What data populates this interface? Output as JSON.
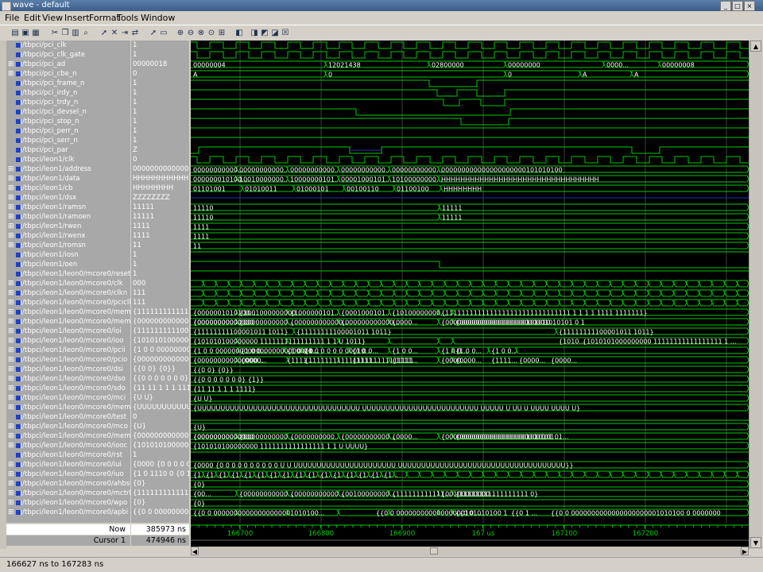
{
  "window": {
    "title": "wave - default",
    "buttons": [
      "_",
      "□",
      "×"
    ]
  },
  "menu": [
    "File",
    "Edit",
    "View",
    "Insert",
    "Format",
    "Tools",
    "Window"
  ],
  "toolbar_icons": [
    "open-icon",
    "save-icon",
    "print-icon",
    "cut-icon",
    "copy-icon",
    "paste-icon",
    "find-icon",
    "select-icon",
    "delete-icon",
    "insert-icon",
    "move-icon",
    "pointer-icon",
    "zoom-box-icon",
    "zoom-in-icon",
    "zoom-out-icon",
    "zoom-full-icon",
    "zoom-cursor-icon",
    "add-cursor-icon",
    "prev-edge-icon",
    "next-edge-icon",
    "prev-edge2-icon",
    "next-edge2-icon",
    "close-cursor-icon"
  ],
  "signals": [
    {
      "name": "/tbpci/pci_clk",
      "value": "1",
      "exp": false
    },
    {
      "name": "/tbpci/pci_clk_gate",
      "value": "1",
      "exp": false
    },
    {
      "name": "/tbpci/pci_ad",
      "value": "00000018",
      "exp": true
    },
    {
      "name": "/tbpci/pci_cbe_n",
      "value": "0",
      "exp": true
    },
    {
      "name": "/tbpci/pci_frame_n",
      "value": "1",
      "exp": false
    },
    {
      "name": "/tbpci/pci_irdy_n",
      "value": "1",
      "exp": false
    },
    {
      "name": "/tbpci/pci_trdy_n",
      "value": "1",
      "exp": false
    },
    {
      "name": "/tbpci/pci_devsel_n",
      "value": "1",
      "exp": false
    },
    {
      "name": "/tbpci/pci_stop_n",
      "value": "1",
      "exp": false
    },
    {
      "name": "/tbpci/pci_perr_n",
      "value": "1",
      "exp": false
    },
    {
      "name": "/tbpci/pci_serr_n",
      "value": "1",
      "exp": false
    },
    {
      "name": "/tbpci/pci_par",
      "value": "Z",
      "exp": false
    },
    {
      "name": "/tbpci/leon1/clk",
      "value": "0",
      "exp": false
    },
    {
      "name": "/tbpci/leon1/address",
      "value": "000000000000001000",
      "exp": true
    },
    {
      "name": "/tbpci/leon1/data",
      "value": "HHHHHHHHHHHHHHHHH",
      "exp": true
    },
    {
      "name": "/tbpci/leon1/cb",
      "value": "HHHHHHHH",
      "exp": true
    },
    {
      "name": "/tbpci/leon1/dsx",
      "value": "ZZZZZZZZ",
      "exp": true
    },
    {
      "name": "/tbpci/leon1/ramsn",
      "value": "11111",
      "exp": true
    },
    {
      "name": "/tbpci/leon1/ramoen",
      "value": "11111",
      "exp": true
    },
    {
      "name": "/tbpci/leon1/rwen",
      "value": "1111",
      "exp": true
    },
    {
      "name": "/tbpci/leon1/rwenx",
      "value": "1111",
      "exp": true
    },
    {
      "name": "/tbpci/leon1/romsn",
      "value": "11",
      "exp": true
    },
    {
      "name": "/tbpci/leon1/iosn",
      "value": "1",
      "exp": false
    },
    {
      "name": "/tbpci/leon1/oen",
      "value": "1",
      "exp": false
    },
    {
      "name": "/tbpci/leon1/leon0/mcore0/resetn",
      "value": "1",
      "exp": false
    },
    {
      "name": "/tbpci/leon1/leon0/mcore0/clk",
      "value": "000",
      "exp": true
    },
    {
      "name": "/tbpci/leon1/leon0/mcore0/clkn",
      "value": "111",
      "exp": true
    },
    {
      "name": "/tbpci/leon1/leon0/mcore0/pciclk",
      "value": "111",
      "exp": true
    },
    {
      "name": "/tbpci/leon1/leon0/mcore0/memi",
      "value": "{11111111111111111",
      "exp": true
    },
    {
      "name": "/tbpci/leon1/leon0/mcore0/memo",
      "value": "{000000000000000000",
      "exp": true
    },
    {
      "name": "/tbpci/leon1/leon0/mcore0/ioi",
      "value": "{1111111111000010",
      "exp": true
    },
    {
      "name": "/tbpci/leon1/leon0/mcore0/ioo",
      "value": "{1010101000000000",
      "exp": true
    },
    {
      "name": "/tbpci/leon1/leon0/mcore0/pcii",
      "value": "{1 0 0 000000000000",
      "exp": true
    },
    {
      "name": "/tbpci/leon1/leon0/mcore0/pcio",
      "value": "{000000000000000000",
      "exp": true
    },
    {
      "name": "/tbpci/leon1/leon0/mcore0/dsi",
      "value": "{{0 0} {0}}",
      "exp": true
    },
    {
      "name": "/tbpci/leon1/leon0/mcore0/dso",
      "value": "{{0 0 0 0 0 0 0} {1}}",
      "exp": true
    },
    {
      "name": "/tbpci/leon1/leon0/mcore0/sdo",
      "value": "{11 11 1 1 1 1111}",
      "exp": true
    },
    {
      "name": "/tbpci/leon1/leon0/mcore0/mci",
      "value": "{U U}",
      "exp": true
    },
    {
      "name": "/tbpci/leon1/leon0/mcore0/memco",
      "value": "{UUUUUUUUUUUUUU",
      "exp": true
    },
    {
      "name": "/tbpci/leon1/leon0/mcore0/test",
      "value": "0",
      "exp": false
    },
    {
      "name": "/tbpci/leon1/leon0/mcore0/mco",
      "value": "{U}",
      "exp": true
    },
    {
      "name": "/tbpci/leon1/leon0/mcore0/memol",
      "value": "{000000000000000000",
      "exp": true
    },
    {
      "name": "/tbpci/leon1/leon0/mcore0/iooc",
      "value": "{1010101000000000",
      "exp": true
    },
    {
      "name": "/tbpci/leon1/leon0/mcore0/rst",
      "value": "1",
      "exp": false
    },
    {
      "name": "/tbpci/leon1/leon0/mcore0/iui",
      "value": "{0000 {0 0 0 0 0 0 0",
      "exp": true
    },
    {
      "name": "/tbpci/leon1/leon0/mcore0/iuo",
      "value": "{1 0 1110 0 {0 1 1",
      "exp": true
    },
    {
      "name": "/tbpci/leon1/leon0/mcore0/ahbsto",
      "value": "{0}",
      "exp": true
    },
    {
      "name": "/tbpci/leon1/leon0/mcore0/mctrlo",
      "value": "{1111111111111111",
      "exp": true
    },
    {
      "name": "/tbpci/leon1/leon0/mcore0/wpo",
      "value": "{0}",
      "exp": true
    },
    {
      "name": "/tbpci/leon1/leon0/mcore0/apbi",
      "value": "{{0 0 000000000000",
      "exp": true
    }
  ],
  "bus_labels": [
    {
      "row": 2,
      "texts": [
        "00000004",
        "12021438",
        "02800000",
        "00000000",
        "0000...",
        "00000008"
      ]
    },
    {
      "row": 3,
      "texts": [
        "A",
        "0",
        "0",
        "A",
        "A"
      ]
    },
    {
      "row": 13,
      "texts": [
        "00000000000...",
        "00000000000...",
        "00000000000...",
        "00000000000...",
        "00000000000...",
        "000000000000000000000101010100"
      ]
    },
    {
      "row": 14,
      "texts": [
        "000000010100...",
        "10010000000...",
        "10000000101...",
        "00001000101...",
        "10100000000...",
        "HHHHHHHHHHHHHHHHHHHHHHHHHHHHHHHHH"
      ]
    },
    {
      "row": 15,
      "texts": [
        "01101001",
        "01010011",
        "01000101",
        "00100110",
        "01100100",
        "HHHHHHHH"
      ]
    },
    {
      "row": 17,
      "texts": [
        "11110",
        "11111"
      ]
    },
    {
      "row": 18,
      "texts": [
        "11110",
        "11111"
      ]
    },
    {
      "row": 19,
      "texts": [
        "1111"
      ]
    },
    {
      "row": 20,
      "texts": [
        "1111"
      ]
    },
    {
      "row": 21,
      "texts": [
        "11"
      ]
    },
    {
      "row": 28,
      "texts": [
        "{0000001010100...",
        "{1001000000000...",
        "{1000000101...",
        "{0001000101...",
        "{10100000000...",
        "{1111111111111111111111111111111 1 1 1 1 1111 1111111}"
      ]
    },
    {
      "row": 29,
      "texts": [
        "{00000000000...",
        "{00000000000...",
        "{000000000000...",
        "{000000000000...",
        "{0000...",
        "{00000000000000000000101010...",
        "{0000000000000000000001010101 0 1",
        "{00000000000000"
      ]
    },
    {
      "row": 30,
      "texts": [
        "{11111111100001011 1011}",
        "{11111111100001011 1011}",
        "{11111111100001011 1011}"
      ]
    },
    {
      "row": 31,
      "texts": [
        "{101010100000000 1111111111111111 1 1 U 1011}",
        "{1010...",
        "{1010101000000000 11111111111111111 1 ..."
      ]
    },
    {
      "row": 32,
      "texts": [
        "{1 0 0 000000000000000000000000...",
        "{1 0 0...",
        "{1 0 0 0...",
        "{1 0 0 0 0 0 00010...",
        "{1 0 0...",
        "{1 0 0...",
        "{1 0 0...",
        "{1 0 0...",
        "{1 0 0..."
      ]
    },
    {
      "row": 33,
      "texts": [
        "{000000000000000...",
        "{0000...",
        "{1111...",
        "{11111111111111111111111111",
        "{1111...",
        "{1111...",
        "{0000...",
        "{0000...",
        "{1111...",
        "{0000...",
        "{0000..."
      ]
    },
    {
      "row": 34,
      "texts": [
        "{{0 0} {0}}"
      ]
    },
    {
      "row": 35,
      "texts": [
        "{{0 0 0 0 0 0 0} {1}}"
      ]
    },
    {
      "row": 36,
      "texts": [
        "{11 11 1 1 1 1111}"
      ]
    },
    {
      "row": 37,
      "texts": [
        "{U U}"
      ]
    },
    {
      "row": 38,
      "texts": [
        "{UUUUUUUUUUUUUUUUUUUUUUUUUUUUUUUUUUU UUUUUUUUUUUUUUUUUUUUUUUUU UUUUU U UU U UUUU UUUU U}"
      ]
    },
    {
      "row": 40,
      "texts": [
        "{U}"
      ]
    },
    {
      "row": 41,
      "texts": [
        "{000000000000...",
        "{00000000000...",
        "{0000000000...",
        "{00000000000...",
        "{0000...",
        "{000000000000000000001010101...",
        "{00000000000000000000101 01...",
        "{00000000000000"
      ]
    },
    {
      "row": 42,
      "texts": [
        "{101010100000000 1111111111111111 1 1 U UUUU}"
      ]
    },
    {
      "row": 44,
      "texts": [
        "{0000 {0 0 0 0 0 0 0 0 0 0 U U UUUUUUUUUUUUUUUUUUUUUU UUUUUUUUUUUUUUUUUUUUUUUUUUUUUUUUUUUU}}"
      ]
    },
    {
      "row": 45,
      "texts": [
        "{1...",
        "{1...",
        "{1...",
        "{1...",
        "{1...",
        "{1...",
        "{1...",
        "{1...",
        "{1...",
        "{1...",
        "{1...",
        "{1...",
        "{1...",
        "{1...",
        "{1...",
        "{1..."
      ]
    },
    {
      "row": 46,
      "texts": [
        "{0}"
      ]
    },
    {
      "row": 47,
      "texts": [
        "{00...",
        "{00000000000...",
        "{00000000000...",
        "{00100000000...",
        "{111111111111...",
        "{00100000000...",
        "{11111111111111111 0}"
      ]
    },
    {
      "row": 48,
      "texts": [
        "{0}"
      ]
    },
    {
      "row": 49,
      "texts": [
        "{{0 0 00000000000000000001010100...",
        "{{0 0 00000000000000000101010100 1",
        "{{0 0 ...",
        "{{0 1 ...",
        "{{0 0 0000000000000000000001010100 0 0000000"
      ]
    }
  ],
  "footer": {
    "now_label": "Now",
    "now_value": "385973 ns",
    "cursor_label": "Cursor 1",
    "cursor_value": "474946 ns"
  },
  "time_axis": [
    "166700",
    "166800",
    "166900",
    "167 us",
    "167100",
    "167200"
  ],
  "status": "166627 ns to 167283 ns",
  "colors": {
    "wave": "#00c800",
    "bus_z": "#2030c0",
    "background": "#000000",
    "grid": "#404040",
    "cursor": "#c8c800"
  }
}
